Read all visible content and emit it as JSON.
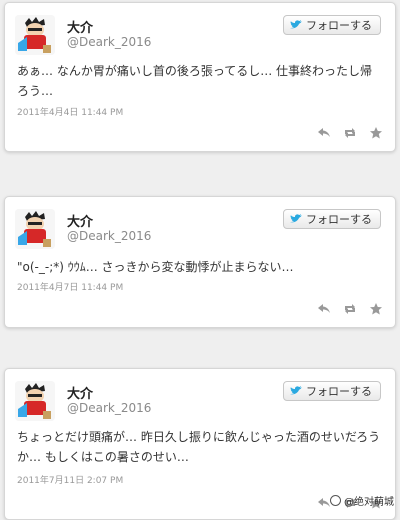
{
  "tweets": [
    {
      "name": "大介",
      "handle": "@Deark_2016",
      "follow_label": "フォローする",
      "text": "あぁ… なんか胃が痛いし首の後ろ張ってるし… 仕事終わったし帰ろう…",
      "timestamp": "2011年4月4日 11:44 PM"
    },
    {
      "name": "大介",
      "handle": "@Deark_2016",
      "follow_label": "フォローする",
      "text": "\"o(-_-;*) ｳｳﾑ… さっきから変な動悸が止まらない…",
      "timestamp": "2011年4月7日 11:44 PM"
    },
    {
      "name": "大介",
      "handle": "@Deark_2016",
      "follow_label": "フォローする",
      "text": "ちょっとだけ頭痛が… 昨日久し振りに飲んじゃった酒のせいだろうか… もしくはこの暑さのせい…",
      "timestamp": "2011年7月11日 2:07 PM"
    }
  ],
  "icons": {
    "follow": "twitter-bird-icon",
    "reply": "reply-icon",
    "retweet": "retweet-icon",
    "favorite": "star-icon"
  },
  "colors": {
    "page_bg": "#efefef",
    "card_bg": "#ffffff",
    "bird": "#2aa9e0",
    "action_icon": "#999999"
  },
  "watermark": "@绝对萌城"
}
